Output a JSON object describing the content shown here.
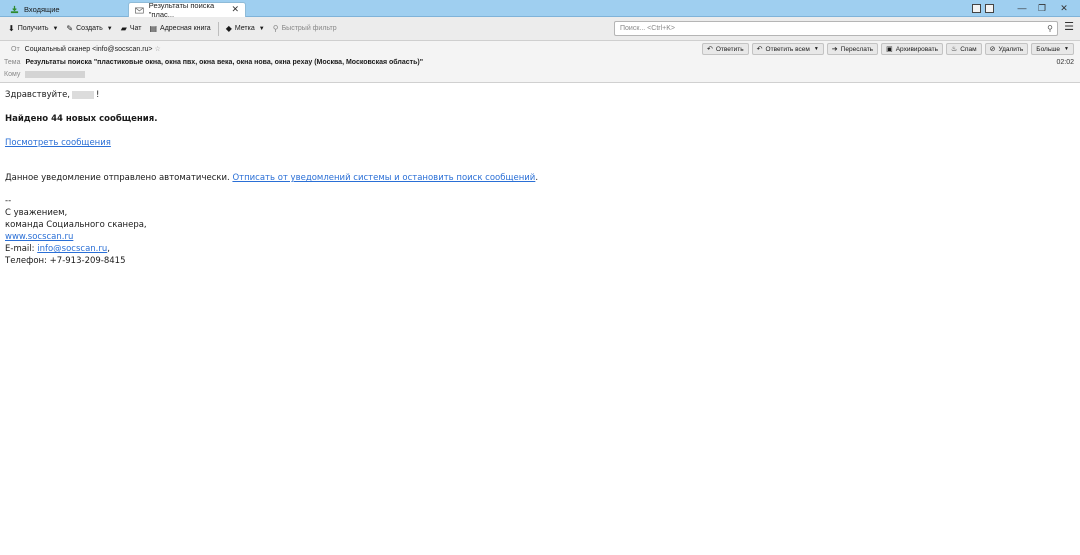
{
  "tabs": [
    {
      "label": "Входящие",
      "active": false
    },
    {
      "label": "Результаты поиска \"плас...",
      "active": true
    }
  ],
  "toolbar": {
    "get": "Получить",
    "compose": "Создать",
    "chat": "Чат",
    "addressbook": "Адресная книга",
    "tag": "Метка",
    "quickfilter": "Быстрый фильтр",
    "search_placeholder": "Поиск... <Ctrl+K>"
  },
  "header": {
    "from_label": "От",
    "from_value": "Социальный сканер <info@socscan.ru>",
    "subject_label": "Тема",
    "subject_value": "Результаты поиска \"пластиковые окна, окна пвх, окна века, окна нова, окна рехау (Москва, Московская область)\"",
    "to_label": "Кому",
    "time": "02:02",
    "actions": {
      "reply": "Ответить",
      "reply_all": "Ответить всем",
      "forward": "Переслать",
      "archive": "Архивировать",
      "spam": "Спам",
      "delete": "Удалить",
      "more": "Больше"
    }
  },
  "message": {
    "greeting": "Здравствуйте,",
    "greeting_end": "!",
    "found": "Найдено 44 новых сообщения.",
    "view_link": "Посмотреть сообщения",
    "notice": "Данное уведомление отправлено автоматически.",
    "unsubscribe_link": "Отписать от уведомлений системы и остановить поиск сообщений",
    "notice_end": ".",
    "sig_dashes": "--",
    "sig_regards": "С уважением,",
    "sig_team": "команда Социального сканера,",
    "sig_site": "www.socscan.ru",
    "sig_email_label": "E-mail: ",
    "sig_email": "info@socscan.ru",
    "sig_email_end": ",",
    "sig_phone": "Телефон: +7-913-209-8415"
  },
  "colors": {
    "tabbar": "#9fcff0",
    "link": "#2a6fd6",
    "toolbar": "#ececec"
  }
}
